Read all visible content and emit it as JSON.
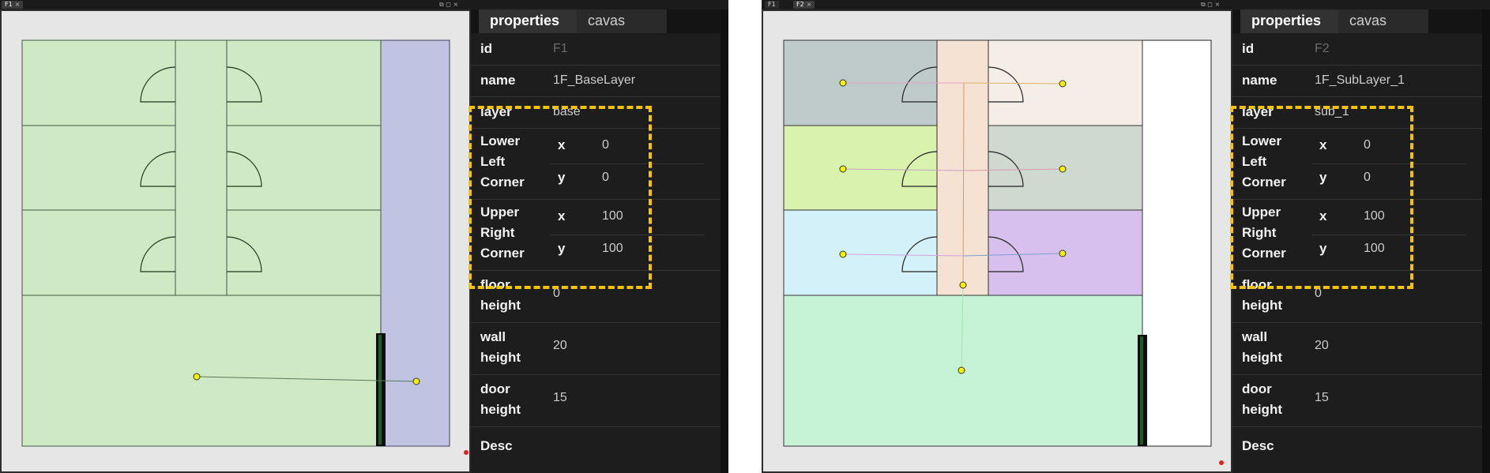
{
  "left": {
    "tabs": [
      {
        "label": "F1",
        "active": true
      }
    ],
    "props": {
      "tab_properties": "properties",
      "tab_canvas": "cavas",
      "id_label": "id",
      "id_value": "F1",
      "name_label": "name",
      "name_value": "1F_BaseLayer",
      "layer_label": "layer",
      "layer_value": "base",
      "llc_label_1": "Lower",
      "llc_label_2": "Left",
      "llc_label_3": "Corner",
      "llc_x": "0",
      "llc_y": "0",
      "urc_label_1": "Upper",
      "urc_label_2": "Right",
      "urc_label_3": "Corner",
      "urc_x": "100",
      "urc_y": "100",
      "floor_label_1": "floor",
      "floor_label_2": "height",
      "floor_value": "0",
      "wall_label_1": "wall",
      "wall_label_2": "height",
      "wall_value": "20",
      "door_label_1": "door",
      "door_label_2": "height",
      "door_value": "15",
      "desc_label": "Desc"
    }
  },
  "right": {
    "tabs": [
      {
        "label": "F1",
        "active": false
      },
      {
        "label": "F2",
        "active": true
      }
    ],
    "props": {
      "tab_properties": "properties",
      "tab_canvas": "cavas",
      "id_label": "id",
      "id_value": "F2",
      "name_label": "name",
      "name_value": "1F_SubLayer_1",
      "layer_label": "layer",
      "layer_value": "sub_1",
      "llc_label_1": "Lower",
      "llc_label_2": "Left",
      "llc_label_3": "Corner",
      "llc_x": "0",
      "llc_y": "0",
      "urc_label_1": "Upper",
      "urc_label_2": "Right",
      "urc_label_3": "Corner",
      "urc_x": "100",
      "urc_y": "100",
      "floor_label_1": "floor",
      "floor_label_2": "height",
      "floor_value": "0",
      "wall_label_1": "wall",
      "wall_label_2": "height",
      "wall_value": "20",
      "door_label_1": "door",
      "door_label_2": "height",
      "door_value": "15",
      "desc_label": "Desc"
    }
  },
  "axis_x": "x",
  "axis_y": "y",
  "tab_close": "×",
  "window_controls": "⧉ ◻ ×",
  "colors": {
    "highlight": "#f5c400",
    "room_green": "#cfe9c5",
    "side_blue": "#c0c4e2",
    "node_yellow": "#f7f200"
  }
}
